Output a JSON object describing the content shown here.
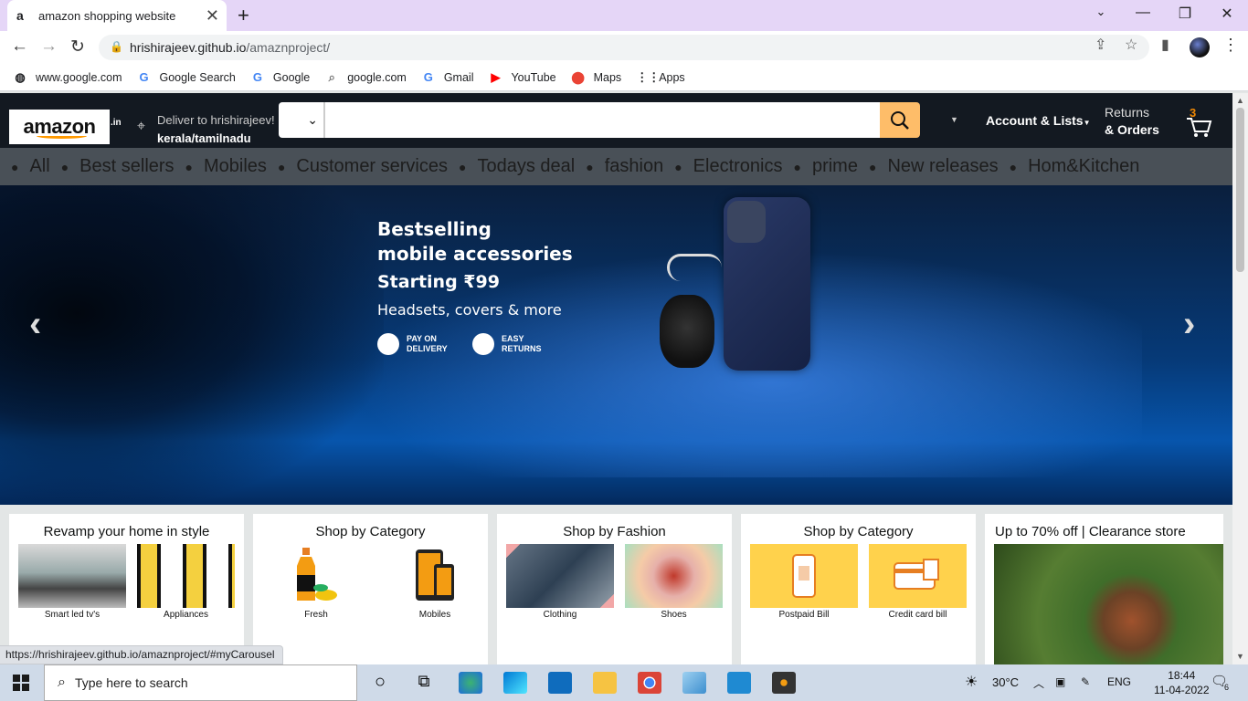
{
  "browser": {
    "tab_title": "amazon shopping website",
    "tab_favicon": "a",
    "url_host": "hrishirajeev.github.io",
    "url_path": "/amaznproject/",
    "bookmarks": [
      {
        "label": "www.google.com",
        "icon": "globe-icon"
      },
      {
        "label": "Google Search",
        "icon": "google-icon"
      },
      {
        "label": "Google",
        "icon": "google-icon"
      },
      {
        "label": "google.com",
        "icon": "search-icon"
      },
      {
        "label": "Gmail",
        "icon": "google-icon"
      },
      {
        "label": "YouTube",
        "icon": "youtube-icon"
      },
      {
        "label": "Maps",
        "icon": "maps-icon"
      },
      {
        "label": "Apps",
        "icon": "apps-grid-icon"
      }
    ],
    "status_url": "https://hrishirajeev.github.io/amaznproject/#myCarousel"
  },
  "header": {
    "logo_word": "amazon",
    "logo_suffix": ".in",
    "deliver_line1": "Deliver to hrishirajeev!",
    "deliver_line2": "kerala/tamilnadu",
    "search_value": "",
    "account": "Account & Lists",
    "returns_line1": "Returns",
    "returns_line2": "& Orders",
    "cart_count": "3",
    "accent": "#febd69",
    "bg": "#131921"
  },
  "subnav": {
    "items": [
      "All",
      "Best sellers",
      "Mobiles",
      "Customer services",
      "Todays deal",
      "fashion",
      "Electronics",
      "prime",
      "New releases",
      "Hom&Kitchen"
    ]
  },
  "carousel": {
    "line1": "Bestselling",
    "line2": "mobile accessories",
    "line3": "Starting ₹99",
    "line4": "Headsets, covers & more",
    "badge1_line1": "PAY ON",
    "badge1_line2": "DELIVERY",
    "badge2_line1": "EASY",
    "badge2_line2": "RETURNS",
    "prev": "‹",
    "next": "›"
  },
  "cards": [
    {
      "title": "Revamp your home in style",
      "tiles": [
        "Smart led tv's",
        "Appliances"
      ]
    },
    {
      "title": "Shop by Category",
      "tiles": [
        "Fresh",
        "Mobiles"
      ]
    },
    {
      "title": "Shop by Fashion",
      "tiles": [
        "Clothing",
        "Shoes"
      ]
    },
    {
      "title": "Shop by Category",
      "tiles": [
        "Postpaid Bill",
        "Credit card bill"
      ]
    },
    {
      "title": "Up to 70% off | Clearance store",
      "tiles": []
    }
  ],
  "taskbar": {
    "search_placeholder": "Type here to search",
    "weather": "30°C",
    "lang": "ENG",
    "time": "18:44",
    "date": "11-04-2022",
    "notifications": "6"
  }
}
